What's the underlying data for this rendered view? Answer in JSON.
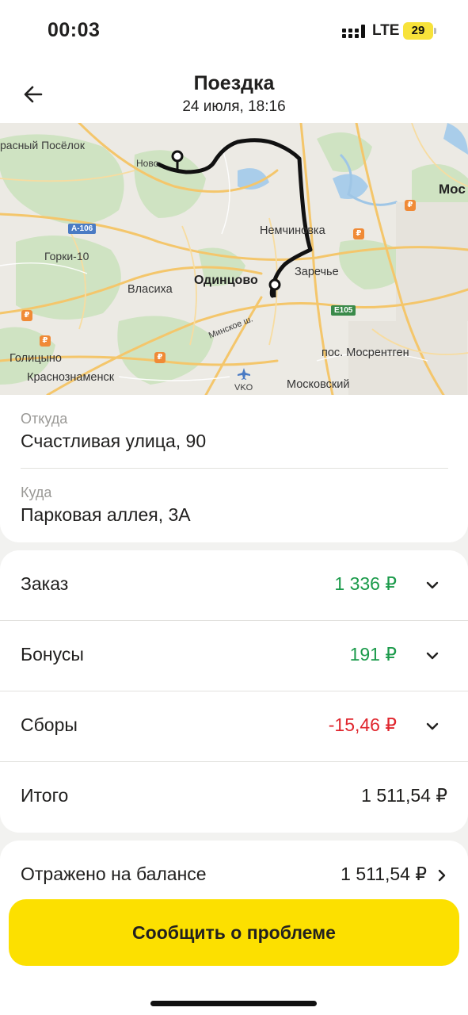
{
  "status_bar": {
    "time": "00:03",
    "network": "LTE",
    "battery": "29"
  },
  "header": {
    "title": "Поездка",
    "subtitle": "24 июля, 18:16"
  },
  "map": {
    "labels": {
      "krasny": "расный Посёлок",
      "novo": "Ново",
      "a106": "А-106",
      "gorki": "Горки-10",
      "nemchinovka": "Немчиновка",
      "zarechye": "Заречье",
      "odintsovo": "Одинцово",
      "vlasikha": "Власиха",
      "minskoe": "Минское ш.",
      "e105": "E105",
      "golitsyno": "Голицыно",
      "krasnoznamensk": "Краснознаменск",
      "vko": "VKO",
      "mosrentgen": "пос. Мосрентген",
      "moskovsky": "Московский",
      "moscow": "Мос"
    }
  },
  "trip": {
    "from_caption": "Откуда",
    "from_address": "Счастливая улица, 90",
    "to_caption": "Куда",
    "to_address": "Парковая аллея, 3А"
  },
  "payment": {
    "order": {
      "label": "Заказ",
      "amount": "1 336 ₽"
    },
    "bonuses": {
      "label": "Бонусы",
      "amount": "191 ₽"
    },
    "fees": {
      "label": "Сборы",
      "amount": "-15,46 ₽"
    },
    "total": {
      "label": "Итого",
      "amount": "1 511,54 ₽"
    }
  },
  "balance": {
    "label": "Отражено на балансе",
    "amount": "1 511,54 ₽"
  },
  "report_button": "Сообщить о проблеме",
  "colors": {
    "positive": "#1a9a4a",
    "negative": "#e0262e",
    "accent": "#fce000"
  }
}
